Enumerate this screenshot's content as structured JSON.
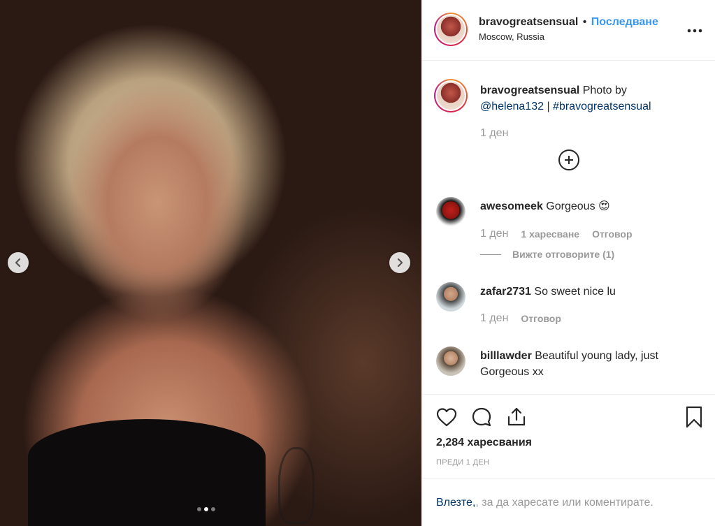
{
  "post": {
    "author": "bravogreatsensual",
    "follow_label": "Последване",
    "separator": "•",
    "location": "Moscow, Russia",
    "carousel_total": 3,
    "carousel_active": 2
  },
  "caption": {
    "username": "bravogreatsensual",
    "text": "Photo by",
    "mention": "@helena132",
    "divider": "|",
    "hashtag": "#bravogreatsensual",
    "time": "1 ден"
  },
  "comments": [
    {
      "username": "awesomeek",
      "text": "Gorgeous 😍",
      "time": "1 ден",
      "likes": "1 харесване",
      "reply": "Отговор"
    },
    {
      "username": "zafar2731",
      "text": "So sweet nice lu",
      "time": "1 ден",
      "reply": "Отговор"
    },
    {
      "username": "billlawder",
      "text": "Beautiful young lady, just Gorgeous xx"
    }
  ],
  "view_replies": "Вижте отговорите (1)",
  "stats": {
    "likes": "2,284 харесвания",
    "posted": "ПРЕДИ 1 ДЕН"
  },
  "login": {
    "link": "Влезте,",
    "text": ", за да харесате или коментирате."
  },
  "icons": {
    "prev": "chevron-left-icon",
    "next": "chevron-right-icon",
    "more": "more-icon",
    "load_more": "plus-circle-icon",
    "like": "heart-icon",
    "comment": "comment-icon",
    "share": "share-icon",
    "save": "bookmark-icon"
  },
  "colors": {
    "accent": "#3897f0",
    "link": "#003569",
    "muted": "#999999"
  }
}
